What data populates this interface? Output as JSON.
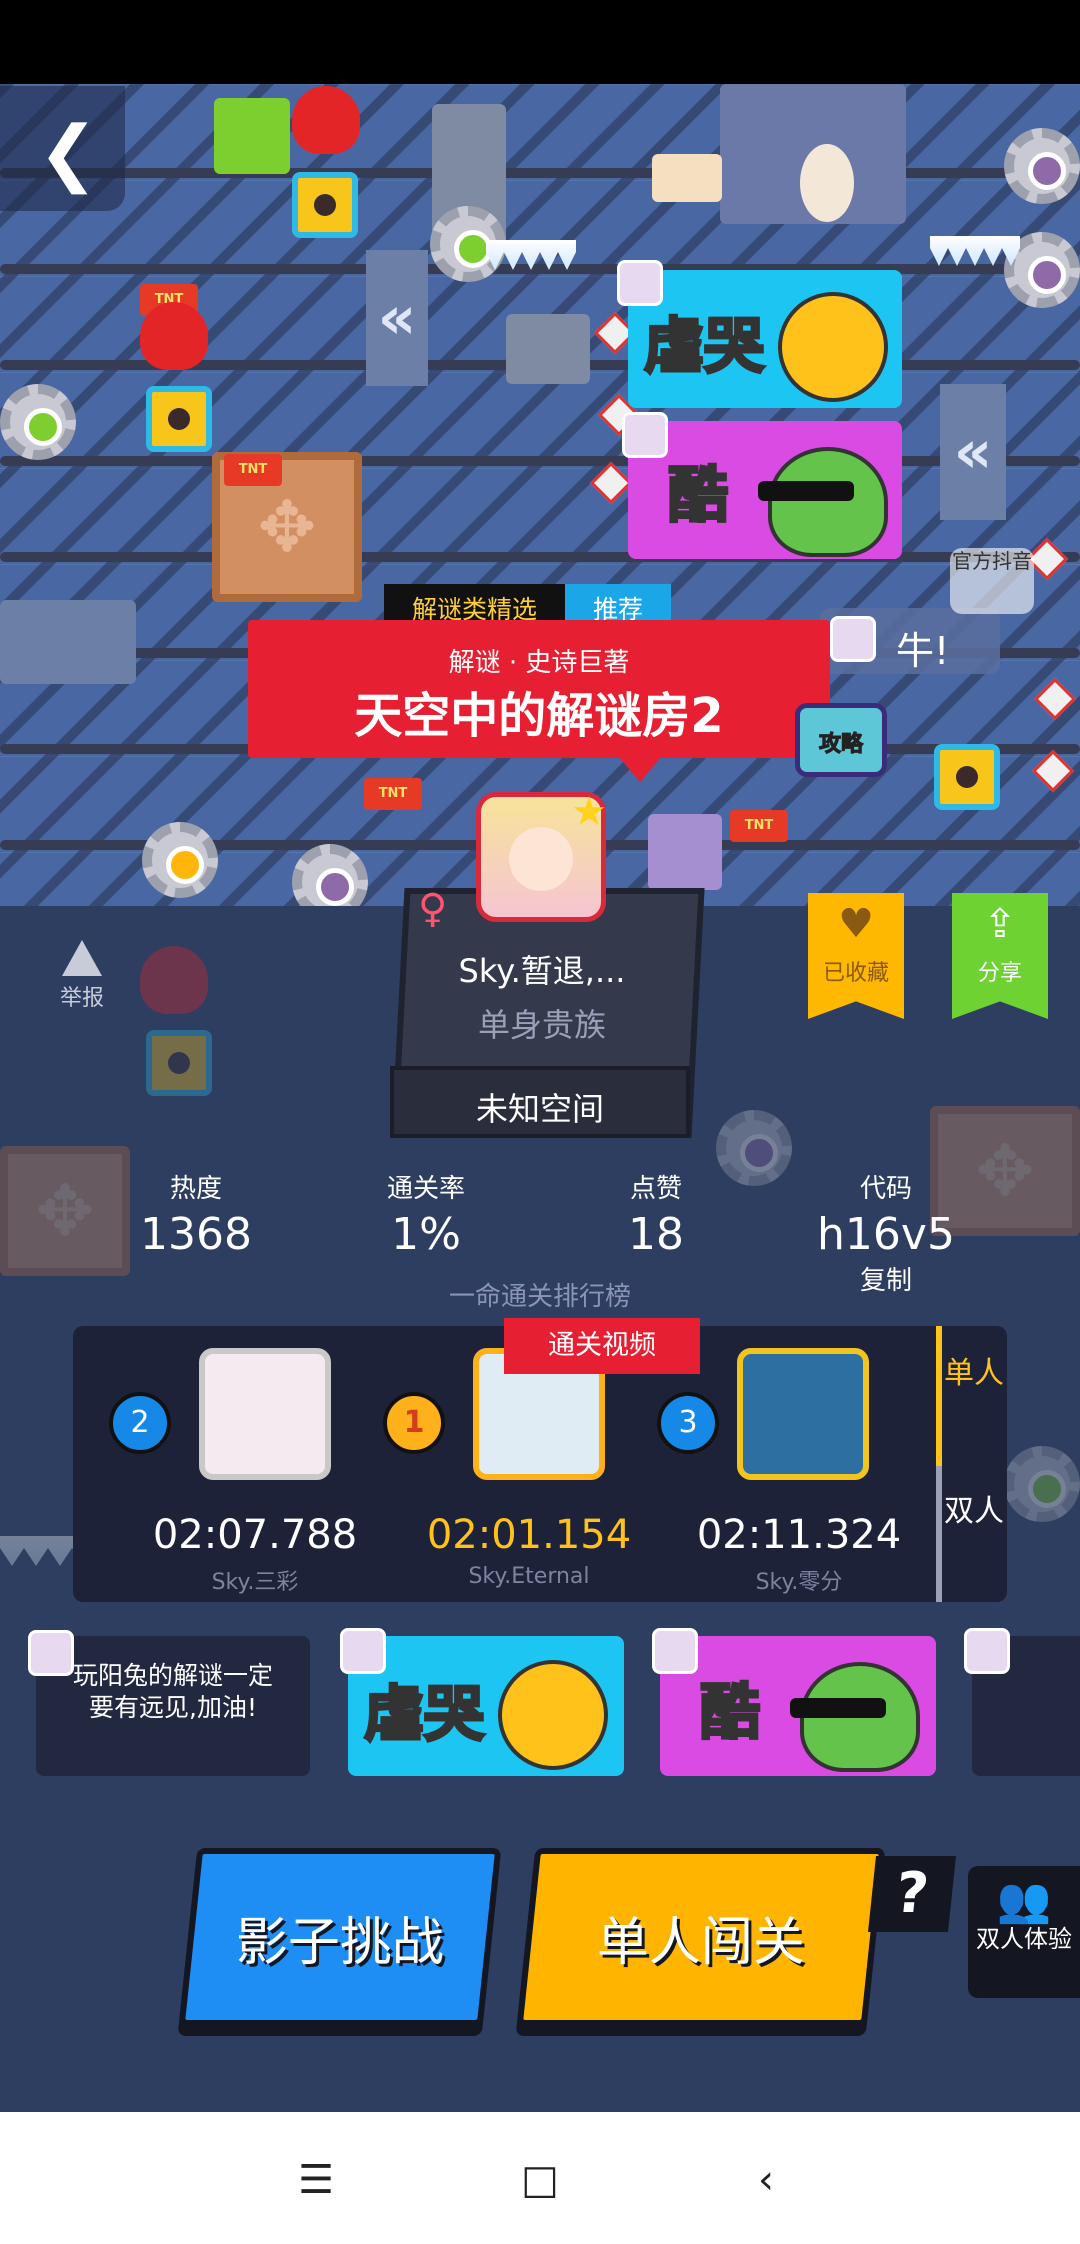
{
  "level": {
    "category_tag": "解谜类精选",
    "recommend_tag": "推荐",
    "subtitle": "解谜 · 史诗巨著",
    "title": "天空中的解谜房2",
    "guide_label": "攻略"
  },
  "scene": {
    "official_douyin": "官方抖音",
    "floating_comment": "牛!",
    "stickers": [
      {
        "text": "虐哭",
        "bg": "#1dc6f2"
      },
      {
        "text": "酷",
        "bg": "#d94be3"
      }
    ]
  },
  "author": {
    "name": "Sky.暂退,...",
    "title": "单身贵族",
    "space": "未知空间",
    "gender": "♀"
  },
  "actions": {
    "report": "举报",
    "favorite": "已收藏",
    "share": "分享"
  },
  "stats": [
    {
      "label": "热度",
      "value": "1368"
    },
    {
      "label": "通关率",
      "value": "1%"
    },
    {
      "label": "点赞",
      "value": "18"
    },
    {
      "label": "代码",
      "value": "h16v5"
    }
  ],
  "copy_label": "复制",
  "ranking": {
    "title": "一命通关排行榜",
    "video_tag": "通关视频",
    "entries": [
      {
        "rank": "2",
        "time": "02:07.788",
        "name": "Sky.三彩"
      },
      {
        "rank": "1",
        "time": "02:01.154",
        "name": "Sky.Eternal"
      },
      {
        "rank": "3",
        "time": "02:11.324",
        "name": "Sky.零分"
      }
    ],
    "modes": {
      "single": "单人",
      "double": "双人"
    }
  },
  "comments": {
    "text_comment": "玩阳兔的解谜一定要有远见,加油!",
    "stickers": [
      {
        "text": "虐哭",
        "bg": "#1dc6f2"
      },
      {
        "text": "酷",
        "bg": "#d94be3"
      }
    ]
  },
  "buttons": {
    "shadow_challenge": "影子挑战",
    "solo_play": "单人闯关",
    "help": "?",
    "duo_trial": "双人体验"
  },
  "colors": {
    "accent_red": "#e61f33",
    "accent_yellow": "#ffb400",
    "accent_blue": "#1e8df4",
    "accent_green": "#6ed233"
  },
  "nav": {
    "menu_icon": "menu-icon",
    "home_icon": "home-icon",
    "back_icon": "back-icon"
  }
}
